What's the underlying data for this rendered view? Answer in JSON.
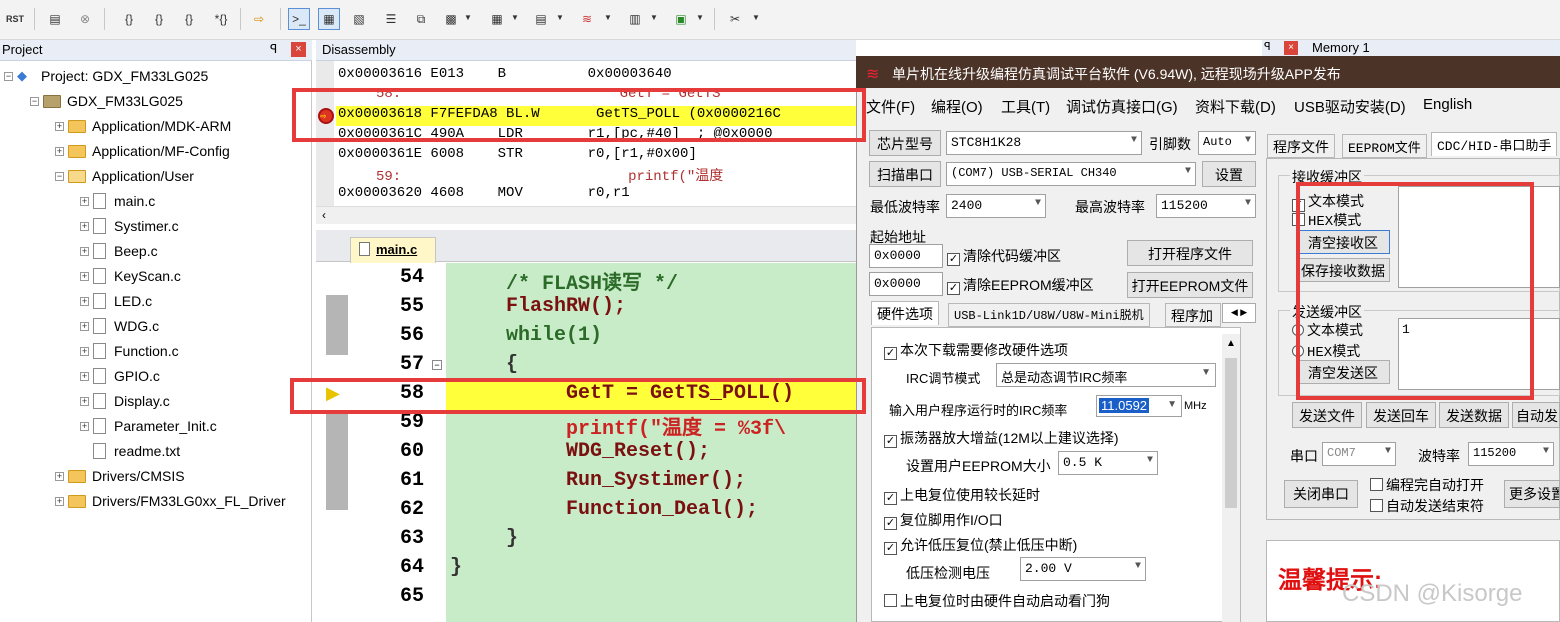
{
  "toolbar": {
    "icons": [
      "rst-icon",
      "build-icon",
      "stop-icon",
      "step-into-icon",
      "step-over-icon",
      "step-out-icon",
      "run-to-cursor-icon",
      "show-next-icon",
      "command-window-icon",
      "disassembly-window-icon",
      "symbols-window-icon",
      "registers-window-icon",
      "call-stack-icon",
      "watch-window-icon",
      "memory-window-icon",
      "serial-window-icon",
      "analysis-window-icon",
      "trace-window-icon",
      "system-viewer-icon",
      "toolbox-icon"
    ],
    "rst_label": "RST"
  },
  "project_panel": {
    "title": "Project",
    "pin": "ꟼ",
    "close": "×",
    "root": "Project: GDX_FM33LG025",
    "target": "GDX_FM33LG025",
    "groups": [
      {
        "label": "Application/MDK-ARM",
        "expanded": false
      },
      {
        "label": "Application/MF-Config",
        "expanded": false
      },
      {
        "label": "Application/User",
        "expanded": true
      }
    ],
    "files": [
      "main.c",
      "Systimer.c",
      "Beep.c",
      "KeyScan.c",
      "LED.c",
      "WDG.c",
      "Function.c",
      "GPIO.c",
      "Display.c",
      "Parameter_Init.c",
      "readme.txt"
    ],
    "more_groups": [
      "Drivers/CMSIS",
      "Drivers/FM33LG0xx_FL_Driver"
    ]
  },
  "disassembly": {
    "title": "Disassembly",
    "lines": [
      {
        "addr": "0x00003616",
        "hex": "E013",
        "op": "B",
        "args": "0x00003640"
      },
      {
        "src": "58:",
        "text": "GetT = GetTS"
      },
      {
        "addr": "0x00003618",
        "hex": "F7FEFDA8",
        "op": "BL.W",
        "args": "GetTS_POLL (0x0000216C"
      },
      {
        "addr": "0x0000361C",
        "hex": "490A",
        "op": "LDR",
        "args": "r1,[pc,#40]  ; @0x0000"
      },
      {
        "addr": "0x0000361E",
        "hex": "6008",
        "op": "STR",
        "args": "r0,[r1,#0x00]"
      },
      {
        "src": "59:",
        "text": "printf(\"温度"
      },
      {
        "addr": "0x00003620",
        "hex": "4608",
        "op": "MOV",
        "args": "r0,r1"
      }
    ]
  },
  "editor": {
    "tab": "main.c",
    "lines": [
      {
        "n": "54",
        "code": "/* FLASH读写 */"
      },
      {
        "n": "55",
        "code": "FlashRW();"
      },
      {
        "n": "56",
        "code": "while(1)"
      },
      {
        "n": "57",
        "code": "{"
      },
      {
        "n": "58",
        "code": "GetT = GetTS_POLL()"
      },
      {
        "n": "59",
        "code": "printf(\"温度 = %3f\\"
      },
      {
        "n": "60",
        "code": "WDG_Reset();"
      },
      {
        "n": "61",
        "code": "Run_Systimer();"
      },
      {
        "n": "62",
        "code": "Function_Deal();"
      },
      {
        "n": "63",
        "code": "}"
      },
      {
        "n": "64",
        "code": "}"
      },
      {
        "n": "65",
        "code": ""
      }
    ]
  },
  "stc": {
    "title": "单片机在线升级编程仿真调试平台软件 (V6.94W), 远程现场升级APP发布",
    "menus": [
      "文件(F)",
      "编程(O)",
      "工具(T)",
      "调试仿真接口(G)",
      "资料下载(D)",
      "USB驱动安装(D)",
      "English"
    ],
    "chip_label": "芯片型号",
    "chip_value": "STC8H1K28",
    "pin_label": "引脚数",
    "pin_value": "Auto",
    "scan_button": "扫描串口",
    "port_value": "(COM7) USB-SERIAL CH340",
    "settings_button": "设置",
    "min_baud_label": "最低波特率",
    "min_baud_value": "2400",
    "max_baud_label": "最高波特率",
    "max_baud_value": "115200",
    "start_addr_label": "起始地址",
    "addr1": "0x0000",
    "addr2": "0x0000",
    "clear_code": "清除代码缓冲区",
    "clear_eeprom": "清除EEPROM缓冲区",
    "open_prog": "打开程序文件",
    "open_eeprom": "打开EEPROM文件",
    "hw_tabs": [
      "硬件选项",
      "USB-Link1D/U8W/U8W-Mini脱机",
      "程序加"
    ],
    "hw_options": {
      "opt1": "本次下载需要修改硬件选项",
      "irc_mode_label": "IRC调节模式",
      "irc_mode_value": "总是动态调节IRC频率",
      "irc_freq_label": "输入用户程序运行时的IRC频率",
      "irc_freq_value": "11.0592",
      "irc_unit": "MHz",
      "amp": "振荡器放大增益(12M以上建议选择)",
      "eeprom_size_label": "设置用户EEPROM大小",
      "eeprom_size_value": "0.5 K",
      "power_delay": "上电复位使用较长延时",
      "reset_io": "复位脚用作I/O口",
      "low_volt": "允许低压复位(禁止低压中断)",
      "low_volt_label": "低压检测电压",
      "low_volt_value": "2.00 V",
      "watchdog": "上电复位时由硬件自动启动看门狗"
    },
    "right_tabs": [
      "程序文件",
      "EEPROM文件",
      "CDC/HID-串口助手"
    ],
    "rx_group": "接收缓冲区",
    "rx_text_mode": "文本模式",
    "rx_hex_mode": "HEX模式",
    "rx_clear": "清空接收区",
    "rx_save": "保存接收数据",
    "tx_group": "发送缓冲区",
    "tx_text_mode": "文本模式",
    "tx_hex_mode": "HEX模式",
    "tx_clear": "清空发送区",
    "tx_value": "1",
    "send_file": "发送文件",
    "send_return": "发送回车",
    "send_data": "发送数据",
    "auto_send": "自动发",
    "port_label": "串口",
    "port_small": "COM7",
    "baud_label": "波特率",
    "baud_value": "115200",
    "close_port": "关闭串口",
    "auto_open": "编程完自动打开",
    "auto_end": "自动发送结束符",
    "more_settings": "更多设置",
    "tip": "温馨提示:"
  },
  "memory_tab": "Memory 1",
  "watermark": "CSDN @Kisorge",
  "colors": {
    "highlight": "#ffff3a",
    "code_bg": "#c8ebc8",
    "red_box": "#e53b3b",
    "title_bg": "#4c3328"
  }
}
